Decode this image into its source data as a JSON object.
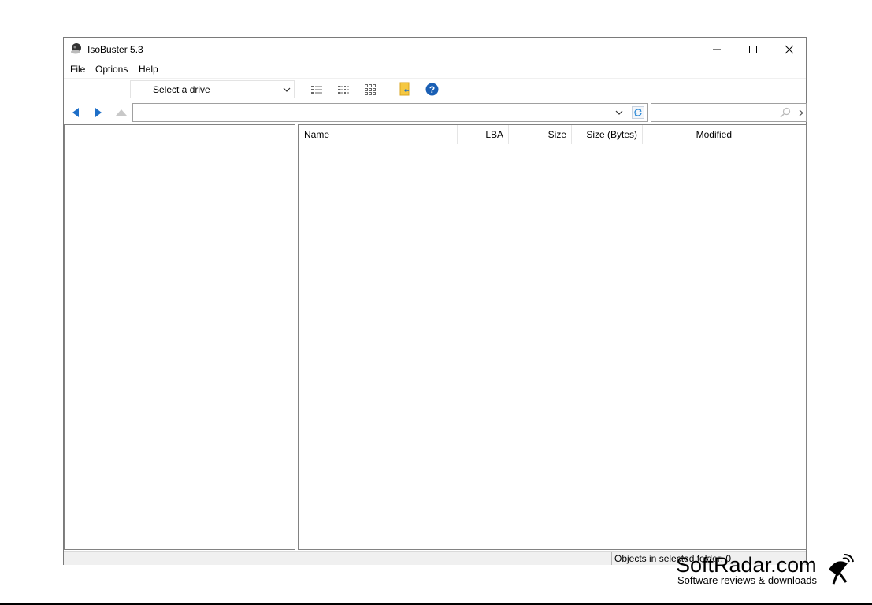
{
  "window": {
    "title": "IsoBuster 5.3"
  },
  "menu": {
    "file": "File",
    "options": "Options",
    "help": "Help"
  },
  "toolbar": {
    "drive_select": "Select a drive",
    "icons": [
      "details-view-icon",
      "list-view-icon",
      "grid-view-icon",
      "extract-folder-icon",
      "help-icon"
    ]
  },
  "navigation": {
    "address_value": "",
    "search_value": ""
  },
  "file_list": {
    "columns": [
      "Name",
      "LBA",
      "Size",
      "Size (Bytes)",
      "Modified"
    ],
    "rows": []
  },
  "status": {
    "objects": "Objects in selected folder: 0"
  },
  "colors": {
    "nav_arrow_blue": "#1e6fc8",
    "help_blue": "#1a5fb4",
    "folder_yellow": "#f5c842"
  }
}
